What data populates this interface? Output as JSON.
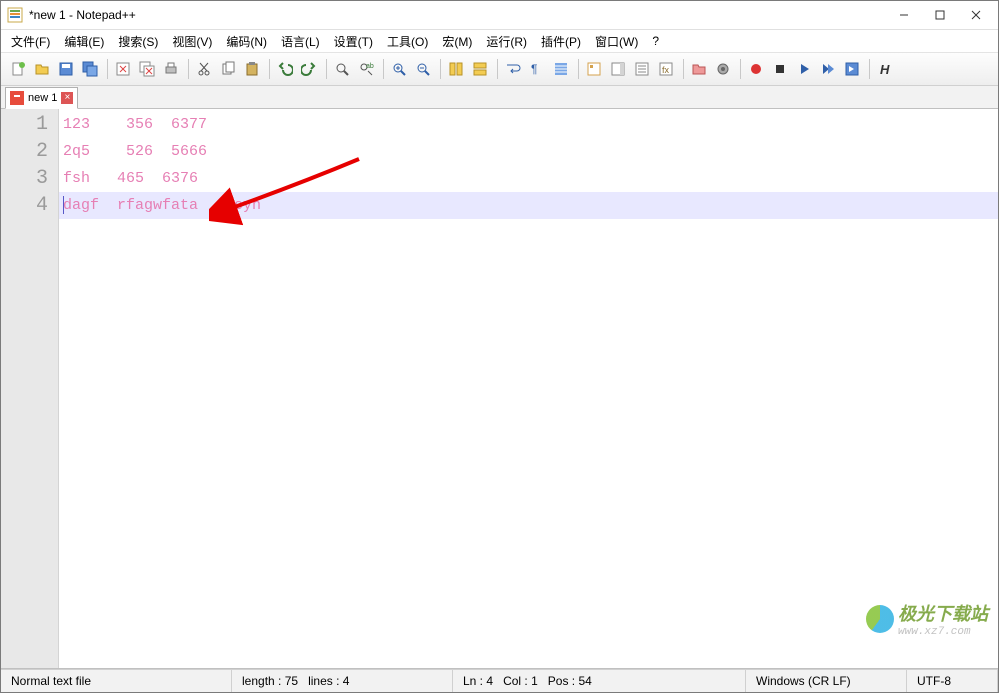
{
  "window": {
    "title": "*new 1 - Notepad++"
  },
  "menu": {
    "file": "文件(F)",
    "edit": "编辑(E)",
    "search": "搜索(S)",
    "view": "视图(V)",
    "encoding": "编码(N)",
    "language": "语言(L)",
    "settings": "设置(T)",
    "tools": "工具(O)",
    "macro": "宏(M)",
    "run": "运行(R)",
    "plugins": "插件(P)",
    "window": "窗口(W)",
    "help": "?"
  },
  "tab": {
    "label": "new 1"
  },
  "lines": [
    "123    356  6377",
    "2q5    526  5666",
    "fsh   465  6376",
    "dagf  rfagwfata   tsyh"
  ],
  "status": {
    "filetype": "Normal text file",
    "length_label": "length :",
    "length_value": "75",
    "lines_label": "lines :",
    "lines_value": "4",
    "ln_label": "Ln :",
    "ln_value": "4",
    "col_label": "Col :",
    "col_value": "1",
    "pos_label": "Pos :",
    "pos_value": "54",
    "eol": "Windows (CR LF)",
    "encoding": "UTF-8"
  },
  "watermark": {
    "text": "极光下载站",
    "url": "www.xz7.com"
  }
}
